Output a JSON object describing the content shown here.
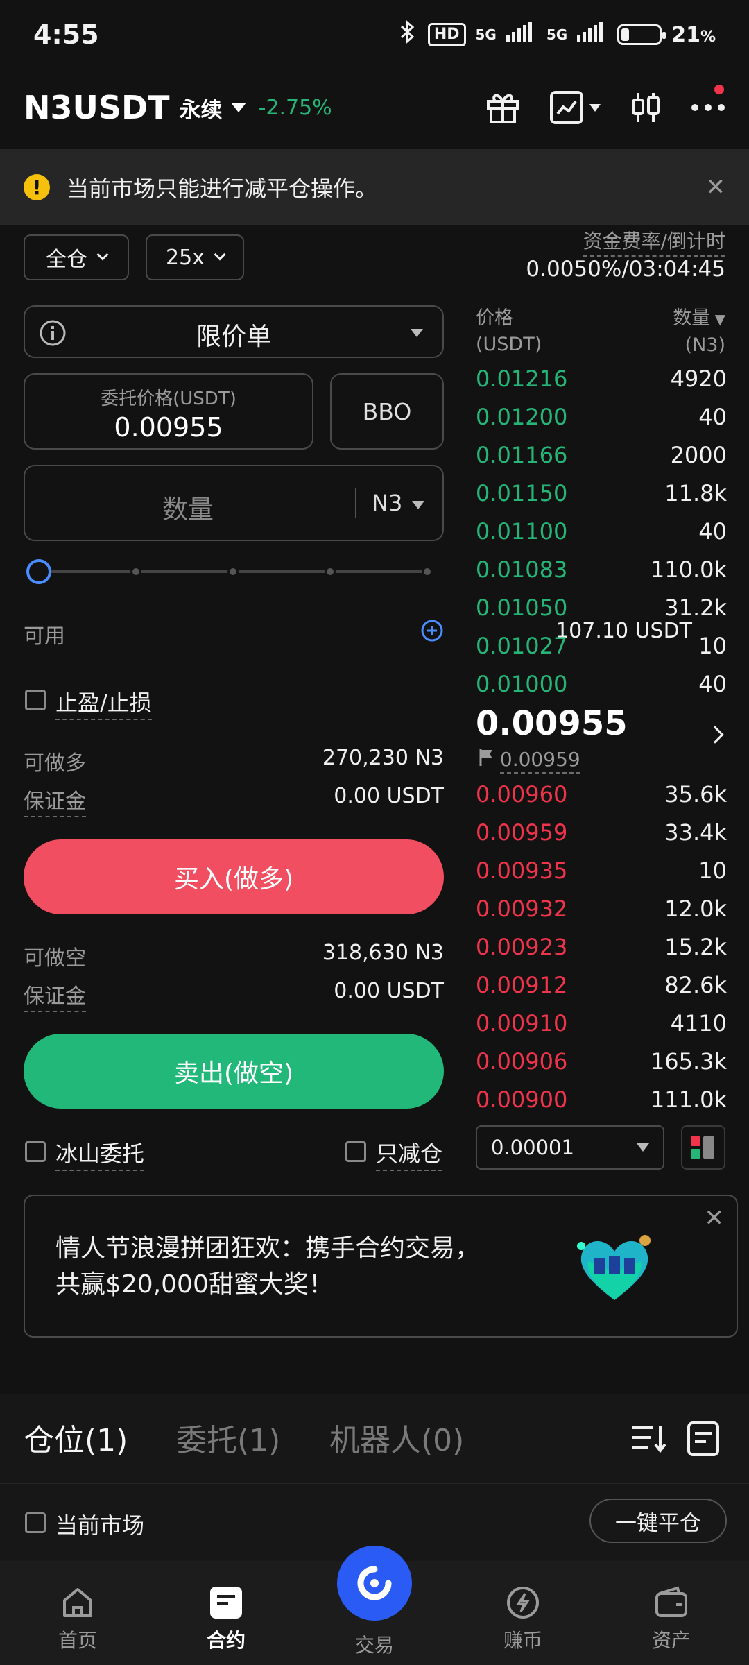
{
  "status_bar": {
    "time": "4:55",
    "hd": "HD",
    "net1": "5G",
    "net2": "5G",
    "battery": "21",
    "battery_unit": "%",
    "battery_level": 0.21
  },
  "header": {
    "symbol": "N3USDT",
    "contract_type": "永续",
    "change": "-2.75%"
  },
  "alert": {
    "text": "当前市场只能进行减平仓操作。"
  },
  "margin_mode": "全仓",
  "leverage": "25x",
  "funding": {
    "label": "资金费率/倒计时",
    "value": "0.0050%/03:04:45"
  },
  "order_type": "限价单",
  "price_field": {
    "label": "委托价格(USDT)",
    "value": "0.00955"
  },
  "bbo_label": "BBO",
  "qty_field": {
    "placeholder": "数量",
    "unit": "N3"
  },
  "available": {
    "label": "可用",
    "value": "107.10 USDT"
  },
  "tp_sl_label": "止盈/止损",
  "long": {
    "label": "可做多",
    "value": "270,230 N3",
    "margin_label": "保证金",
    "margin_value": "0.00 USDT",
    "button": "买入(做多)"
  },
  "short": {
    "label": "可做空",
    "value": "318,630 N3",
    "margin_label": "保证金",
    "margin_value": "0.00 USDT",
    "button": "卖出(做空)"
  },
  "iceberg_label": "冰山委托",
  "reduce_only_label": "只减仓",
  "orderbook": {
    "price_header": "价格",
    "price_unit": "(USDT)",
    "qty_header": "数量",
    "qty_unit": "(N3)",
    "asks": [
      {
        "price": "0.01216",
        "qty": "4920"
      },
      {
        "price": "0.01200",
        "qty": "40"
      },
      {
        "price": "0.01166",
        "qty": "2000"
      },
      {
        "price": "0.01150",
        "qty": "11.8k"
      },
      {
        "price": "0.01100",
        "qty": "40"
      },
      {
        "price": "0.01083",
        "qty": "110.0k"
      },
      {
        "price": "0.01050",
        "qty": "31.2k"
      },
      {
        "price": "0.01027",
        "qty": "10"
      },
      {
        "price": "0.01000",
        "qty": "40"
      }
    ],
    "last_price": "0.00955",
    "mark_price": "0.00959",
    "bids": [
      {
        "price": "0.00960",
        "qty": "35.6k"
      },
      {
        "price": "0.00959",
        "qty": "33.4k"
      },
      {
        "price": "0.00935",
        "qty": "10"
      },
      {
        "price": "0.00932",
        "qty": "12.0k"
      },
      {
        "price": "0.00923",
        "qty": "15.2k"
      },
      {
        "price": "0.00912",
        "qty": "82.6k"
      },
      {
        "price": "0.00910",
        "qty": "4110"
      },
      {
        "price": "0.00906",
        "qty": "165.3k"
      },
      {
        "price": "0.00900",
        "qty": "111.0k"
      }
    ],
    "precision": "0.00001"
  },
  "banner": {
    "line1": "情人节浪漫拼团狂欢：携手合约交易，",
    "line2": "共赢$20,000甜蜜大奖！"
  },
  "tabs": {
    "positions": "仓位(1)",
    "orders": "委托(1)",
    "bots": "机器人(0)"
  },
  "current_market_label": "当前市场",
  "close_all_label": "一键平仓",
  "nav": {
    "home": "首页",
    "futures": "合约",
    "trade": "交易",
    "earn": "赚币",
    "assets": "资产"
  }
}
